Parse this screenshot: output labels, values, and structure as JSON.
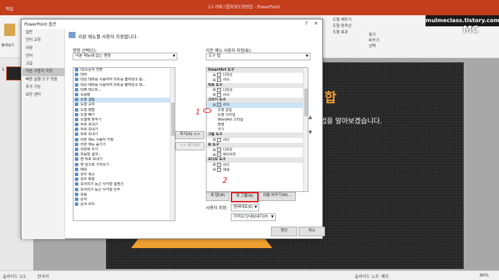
{
  "ppt": {
    "title_text": "13-개체그룹화및도형병합 - PowerPoint",
    "file_tab": "파일",
    "paste_label": "붙여넣기",
    "slide_number": "1",
    "slide_title": "형병합",
    "slide_subtitle": "방법을 알아보겠습니다.",
    "accent_color": "#c43e1c",
    "slide_bg": "#262626",
    "triangle_color": "#f0a030",
    "ribbon_right": [
      "도형 채우기",
      "도형 윤곽선",
      "도형 효과",
      "찾기",
      "바꾸기",
      "선택"
    ],
    "watermark_site": "mulmeclass.tistory.com",
    "watermark_logo": "MC"
  },
  "status": {
    "slide_info": "슬라이드 1/1",
    "language": "한국어",
    "notes": "슬라이드 노트",
    "comments": "메모",
    "zoom": "86%"
  },
  "dialog": {
    "title": "PowerPoint 옵션",
    "nav": [
      "일반",
      "언어 교정",
      "저장",
      "언어",
      "고급",
      "리본 사용자 지정",
      "빠른 실행 도구 모음",
      "추가 기능",
      "보안 센터"
    ],
    "nav_selected": 5,
    "header": "리본 메뉴를 사용자 지정합니다.",
    "choose_label": "명령 선택(C):",
    "choose_value": "리본 메뉴에 없는 명령",
    "customize_label": "리본 메뉴 사용자 지정(B):",
    "customize_value": "도구 탭",
    "left_list": [
      "대/소문자 전환",
      "대비",
      "대상 테마를 사용하여 차트를 붙여넣고 통...",
      "대상 테마를 사용하여 차트를 붙여넣고 데...",
      "대체 텍스트...",
      "도움말",
      "도형 결합",
      "도형 교차",
      "도형 병합",
      "도형 빼기",
      "도형에 맞추기",
      "뒤로 보내기",
      "뒤로 보내기",
      "뒤로 보내기",
      "리본 메뉴 사용자 지정",
      "리본 메뉴 숨기기",
      "리본에 추가",
      "모음형 결과...",
      "맨 뒤로 보내기",
      "맨 앞으로 가져오기",
      "메모",
      "모두 축소",
      "모두 확장",
      "모서리가 둥근 사각형 설명선",
      "모서리가 둥근 사각형 단추",
      "모음",
      "문서",
      "문서 위치"
    ],
    "left_selected": 6,
    "add_button": "추가(A) >>",
    "remove_button": "<< 제거(R)",
    "right_list": [
      {
        "t": "SmartArt 도구",
        "lvl": 0,
        "sec": true
      },
      {
        "t": "디자인",
        "lvl": 1,
        "chk": true
      },
      {
        "t": "서식",
        "lvl": 1,
        "chk": true
      },
      {
        "t": "차트 도구",
        "lvl": 0,
        "sec": true
      },
      {
        "t": "디자인",
        "lvl": 1,
        "chk": true
      },
      {
        "t": "서식",
        "lvl": 1,
        "chk": true
      },
      {
        "t": "그리기 도구",
        "lvl": 0,
        "sec": true
      },
      {
        "t": "서식",
        "lvl": 1,
        "chk": true
      },
      {
        "t": "도형 삽입",
        "lvl": 2
      },
      {
        "t": "도형 스타일",
        "lvl": 2
      },
      {
        "t": "WordArt 스타일",
        "lvl": 2
      },
      {
        "t": "정렬",
        "lvl": 2
      },
      {
        "t": "크기",
        "lvl": 2
      },
      {
        "t": "그림 도구",
        "lvl": 0,
        "sec": true
      },
      {
        "t": "서식",
        "lvl": 1,
        "chk": true
      },
      {
        "t": "표 도구",
        "lvl": 0,
        "sec": true
      },
      {
        "t": "디자인",
        "lvl": 1,
        "chk": true
      },
      {
        "t": "레이아웃",
        "lvl": 1,
        "chk": true
      },
      {
        "t": "오디오 도구",
        "lvl": 0,
        "sec": true
      },
      {
        "t": "서식",
        "lvl": 1,
        "chk": true
      },
      {
        "t": "재생",
        "lvl": 1,
        "chk": true
      }
    ],
    "new_tab_button": "새 탭(W)",
    "new_group_button": "새 그룹(N)",
    "rename_button": "이름 바꾸기(M)...",
    "customize_reset_label": "사용자 지정:",
    "reset_button": "원래대로(E)",
    "import_export_button": "가져오기/내보내기(P)",
    "ok_button": "확인",
    "cancel_button": "취소",
    "annotation_1": "1",
    "annotation_2": "2",
    "annotation_color": "#e02020"
  }
}
